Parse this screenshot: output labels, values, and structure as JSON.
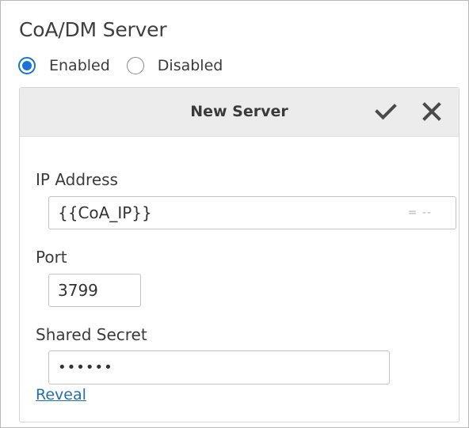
{
  "section": {
    "title": "CoA/DM Server"
  },
  "radios": {
    "enabled_label": "Enabled",
    "disabled_label": "Disabled",
    "selected": "Enabled"
  },
  "card": {
    "title": "New Server",
    "ip": {
      "label": "IP Address",
      "value": "{{CoA_IP}}",
      "suffix": "= --"
    },
    "port": {
      "label": "Port",
      "value": "3799"
    },
    "secret": {
      "label": "Shared Secret",
      "value": "••••••"
    },
    "reveal_label": "Reveal"
  },
  "colors": {
    "accent": "#1a73d9",
    "link": "#1f6fb6",
    "header_bg": "#ececec"
  },
  "icons": {
    "confirm": "check-icon",
    "cancel": "close-icon"
  }
}
